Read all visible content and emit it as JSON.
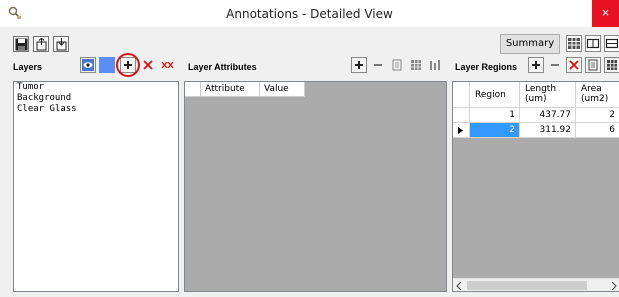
{
  "window": {
    "title": "Annotations - Detailed View",
    "close_glyph": "×"
  },
  "toolbar": {
    "summary_label": "Summary"
  },
  "layers": {
    "label": "Layers",
    "items": [
      "Tumor",
      "Background",
      "Clear Glass"
    ]
  },
  "attributes": {
    "label": "Layer Attributes",
    "columns": [
      "Attribute",
      "Value"
    ]
  },
  "regions": {
    "label": "Layer Regions",
    "columns": [
      "Region",
      "Length\n(um)",
      "Area\n(um2)"
    ],
    "col_region": "Region",
    "col_length_1": "Length",
    "col_length_2": "(um)",
    "col_area_1": "Area",
    "col_area_2": "(um2)",
    "rows": [
      {
        "region": "1",
        "length": "437.77",
        "area": "2",
        "selected": false
      },
      {
        "region": "2",
        "length": "311.92",
        "area": "6",
        "selected": true
      }
    ]
  },
  "colors": {
    "accent_blue": "#3399ff",
    "close_red": "#e81123",
    "highlight_red": "#d4141c",
    "grid_bg": "#ababab"
  },
  "icons": [
    "app-search-icon",
    "save-icon",
    "export-icon",
    "import-icon",
    "grid-icon",
    "columns-icon",
    "eye-icon",
    "color-swatch-icon",
    "add-icon",
    "delete-icon",
    "delete-all-icon",
    "remove-icon",
    "properties-icon",
    "table-icon",
    "bar-chart-icon",
    "scroll-left-icon",
    "scroll-right-icon",
    "row-pointer-icon"
  ]
}
